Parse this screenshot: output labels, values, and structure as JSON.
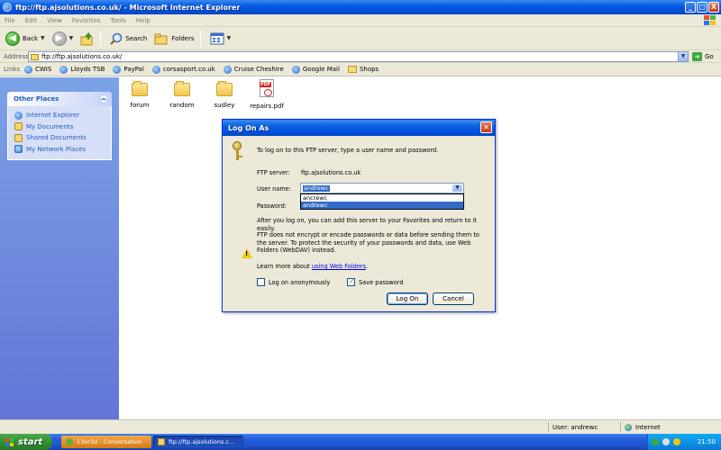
{
  "window": {
    "title": "ftp://ftp.ajsolutions.co.uk/ - Microsoft Internet Explorer",
    "controls": [
      "_",
      "□",
      "X"
    ]
  },
  "menu": [
    "File",
    "Edit",
    "View",
    "Favorites",
    "Tools",
    "Help"
  ],
  "toolbar": {
    "back_label": "Back",
    "search_label": "Search",
    "folders_label": "Folders"
  },
  "address": {
    "label": "Address",
    "value": "ftp://ftp.ajsolutions.co.uk/",
    "go_label": "Go"
  },
  "links": {
    "label": "Links",
    "items": [
      {
        "label": "CWIS",
        "icon": "ie"
      },
      {
        "label": "Lloyds TSB",
        "icon": "ie"
      },
      {
        "label": "PayPal",
        "icon": "ie"
      },
      {
        "label": "corsasport.co.uk",
        "icon": "ie"
      },
      {
        "label": "Cruise Cheshire",
        "icon": "ie"
      },
      {
        "label": "Google Mail",
        "icon": "ie"
      },
      {
        "label": "Shops",
        "icon": "folder"
      }
    ]
  },
  "sidebar": {
    "header": "Other Places",
    "items": [
      {
        "label": "Internet Explorer",
        "icon": "ie-icon"
      },
      {
        "label": "My Documents",
        "icon": "folder-icon"
      },
      {
        "label": "Shared Documents",
        "icon": "folder-icon"
      },
      {
        "label": "My Network Places",
        "icon": "network-icon"
      }
    ]
  },
  "files": [
    {
      "name": "forum",
      "type": "folder"
    },
    {
      "name": "random",
      "type": "folder"
    },
    {
      "name": "sudley",
      "type": "folder"
    },
    {
      "name": "repairs.pdf",
      "type": "pdf"
    }
  ],
  "dialog": {
    "title": "Log On As",
    "intro": "To log on to this FTP server, type a user name and password.",
    "ftp_server_label": "FTP server:",
    "ftp_server_value": "ftp.ajsolutions.co.uk",
    "username_label": "User name:",
    "username_value": "andrewc",
    "password_label": "Password:",
    "dropdown_options": [
      "ancrewc",
      "andrewc"
    ],
    "after_text": "After you log on, you can add this server to your Favorites and return to it easily.",
    "warning_text": "FTP does not encrypt or encode passwords or data before sending them to the server.  To protect the security of your passwords and data, use Web Folders (WebDAV) instead.",
    "learn_more_prefix": "Learn more about",
    "learn_more_link": "using Web Folders",
    "learn_more_suffix": ".",
    "anon_label": "Log on anonymously",
    "anon_checked": false,
    "save_label": "Save password",
    "save_checked": true,
    "logon_button": "Log On",
    "cancel_button": "Cancel"
  },
  "status": {
    "user": "User: andrewc",
    "zone": "Internet"
  },
  "taskbar": {
    "start_label": "start",
    "tasks": [
      {
        "label": "13or3d - Conversation",
        "style": "orange"
      },
      {
        "label": "ftp://ftp.ajsolutions.c...",
        "style": "active"
      }
    ],
    "clock": "21:50"
  }
}
